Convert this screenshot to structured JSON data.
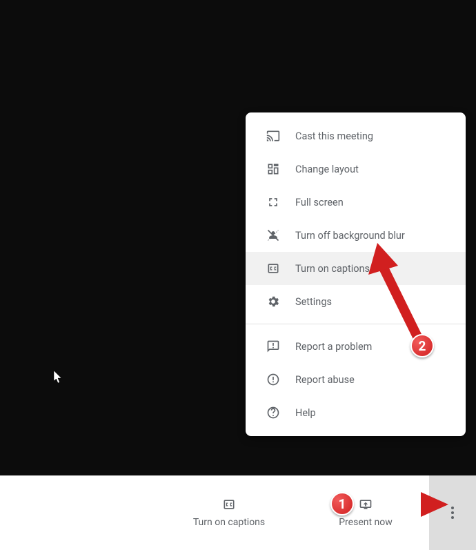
{
  "menu": {
    "items": [
      {
        "label": "Cast this meeting",
        "icon": "cast-icon"
      },
      {
        "label": "Change layout",
        "icon": "layout-icon"
      },
      {
        "label": "Full screen",
        "icon": "fullscreen-icon"
      },
      {
        "label": "Turn off background blur",
        "icon": "blur-icon"
      },
      {
        "label": "Turn on captions",
        "icon": "captions-icon"
      },
      {
        "label": "Settings",
        "icon": "settings-icon"
      }
    ],
    "divider": true,
    "secondary": [
      {
        "label": "Report a problem",
        "icon": "feedback-icon"
      },
      {
        "label": "Report abuse",
        "icon": "warning-icon"
      },
      {
        "label": "Help",
        "icon": "help-icon"
      }
    ]
  },
  "bottom_bar": {
    "captions_label": "Turn on captions",
    "present_label": "Present now"
  },
  "annotations": {
    "step1": "1",
    "step2": "2"
  }
}
